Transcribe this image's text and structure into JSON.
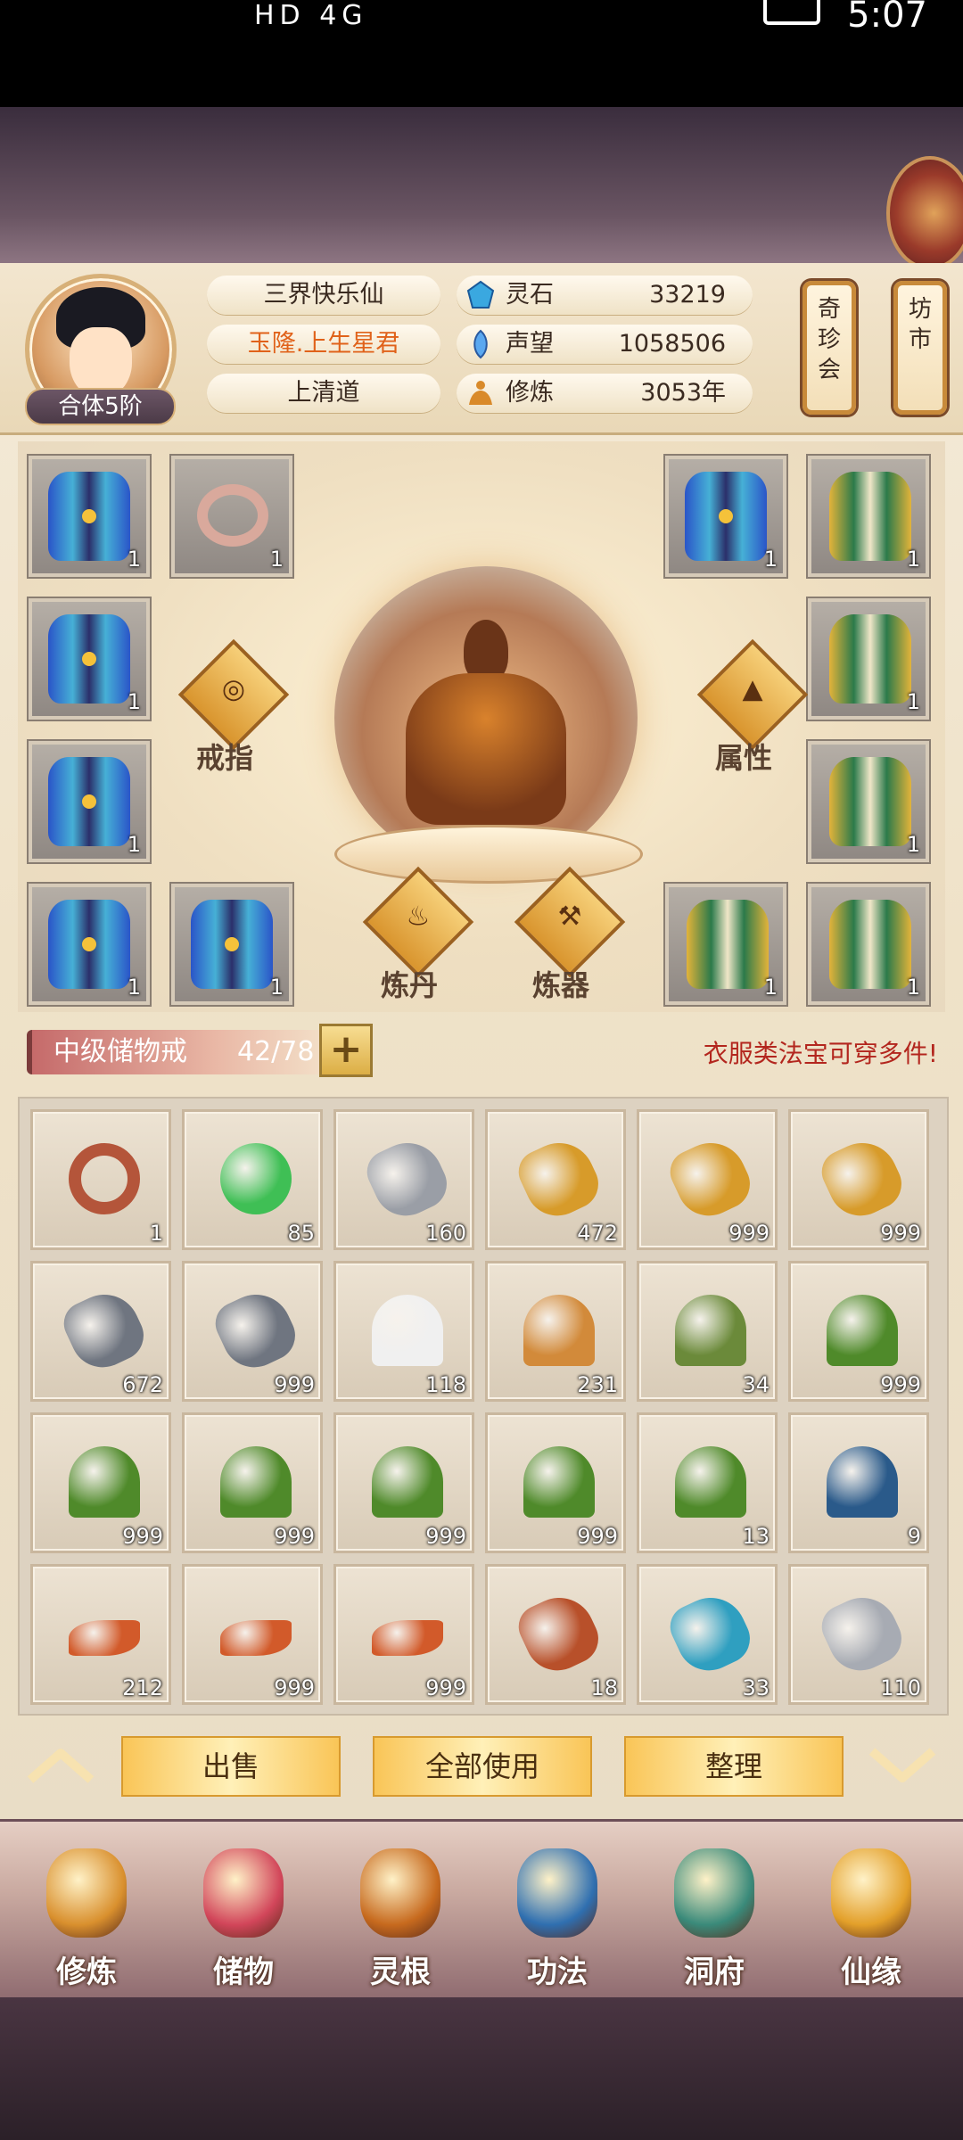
{
  "status_bar": {
    "left_icons": "HD 4G",
    "time": "5:07"
  },
  "profile": {
    "rank": "合体5阶",
    "name": "三界快乐仙",
    "title": "玉隆.上生星君",
    "sect": "上清道"
  },
  "resources": [
    {
      "label": "灵石",
      "value": "33219"
    },
    {
      "label": "声望",
      "value": "1058506"
    },
    {
      "label": "修炼",
      "value": "3053年"
    }
  ],
  "side_buttons": {
    "market_treasures": "奇珍会",
    "market": "坊市"
  },
  "equipment": {
    "left_slots": [
      {
        "icon": "robe",
        "count": "1"
      },
      {
        "icon": "ring",
        "count": "1"
      },
      {
        "icon": "robe",
        "count": "1"
      },
      {
        "icon": "robe",
        "count": "1"
      },
      {
        "icon": "robe",
        "count": "1"
      },
      {
        "icon": "robe",
        "count": "1"
      }
    ],
    "right_slots": [
      {
        "icon": "robe",
        "count": "1"
      },
      {
        "icon": "armor",
        "count": "1"
      },
      {
        "icon": "armor",
        "count": "1"
      },
      {
        "icon": "armor",
        "count": "1"
      },
      {
        "icon": "armor",
        "count": "1"
      },
      {
        "icon": "armor",
        "count": "1"
      }
    ],
    "labels": {
      "ring": "戒指",
      "attributes": "属性",
      "alchemy": "炼丹",
      "forging": "炼器"
    }
  },
  "bag": {
    "name": "中级储物戒",
    "capacity": "42/78",
    "hint": "衣服类法宝可穿多件!"
  },
  "items": [
    {
      "icon": "ring",
      "color": "#b4553a",
      "count": "1"
    },
    {
      "icon": "jade-orb",
      "color": "#3fbf55",
      "count": "85"
    },
    {
      "icon": "silver-ore",
      "color": "#9a9ea6",
      "count": "160"
    },
    {
      "icon": "gold-ore",
      "color": "#d79b2a",
      "count": "472"
    },
    {
      "icon": "gold-ore",
      "color": "#d79b2a",
      "count": "999"
    },
    {
      "icon": "gold-ore",
      "color": "#d79b2a",
      "count": "999"
    },
    {
      "icon": "iron-ore",
      "color": "#6f7580",
      "count": "672"
    },
    {
      "icon": "iron-ore",
      "color": "#6f7580",
      "count": "999"
    },
    {
      "icon": "white-flower",
      "color": "#f0f0f0",
      "count": "118"
    },
    {
      "icon": "ginseng",
      "color": "#d28a3a",
      "count": "231"
    },
    {
      "icon": "herb-root",
      "color": "#6b8a3a",
      "count": "34"
    },
    {
      "icon": "red-herb",
      "color": "#4f8a2a",
      "count": "999"
    },
    {
      "icon": "red-herb",
      "color": "#4f8a2a",
      "count": "999"
    },
    {
      "icon": "red-herb",
      "color": "#4f8a2a",
      "count": "999"
    },
    {
      "icon": "red-herb",
      "color": "#4f8a2a",
      "count": "999"
    },
    {
      "icon": "red-herb",
      "color": "#4f8a2a",
      "count": "999"
    },
    {
      "icon": "red-herb",
      "color": "#4f8a2a",
      "count": "13"
    },
    {
      "icon": "fruit-branch",
      "color": "#2a5a8a",
      "count": "9"
    },
    {
      "icon": "cordyceps",
      "color": "#d25a2a",
      "count": "212"
    },
    {
      "icon": "cordyceps",
      "color": "#d25a2a",
      "count": "999"
    },
    {
      "icon": "cordyceps",
      "color": "#d25a2a",
      "count": "999"
    },
    {
      "icon": "fire-crystal",
      "color": "#b8502a",
      "count": "18"
    },
    {
      "icon": "blue-crystal",
      "color": "#2f9fc0",
      "count": "33"
    },
    {
      "icon": "silver-ore",
      "color": "#a7abb3",
      "count": "110"
    }
  ],
  "actions": {
    "sell": "出售",
    "use_all": "全部使用",
    "sort": "整理"
  },
  "nav": [
    {
      "label": "修炼",
      "icon": "cultivate-icon",
      "color": "#d9902e"
    },
    {
      "label": "储物",
      "icon": "storage-bag-icon",
      "color": "#d2465a"
    },
    {
      "label": "灵根",
      "icon": "spirit-root-icon",
      "color": "#c76a1e"
    },
    {
      "label": "功法",
      "icon": "technique-book-icon",
      "color": "#2f6fb0"
    },
    {
      "label": "洞府",
      "icon": "cave-dwelling-icon",
      "color": "#3a8a7a"
    },
    {
      "label": "仙缘",
      "icon": "fortune-icon",
      "color": "#e3a02a"
    }
  ]
}
